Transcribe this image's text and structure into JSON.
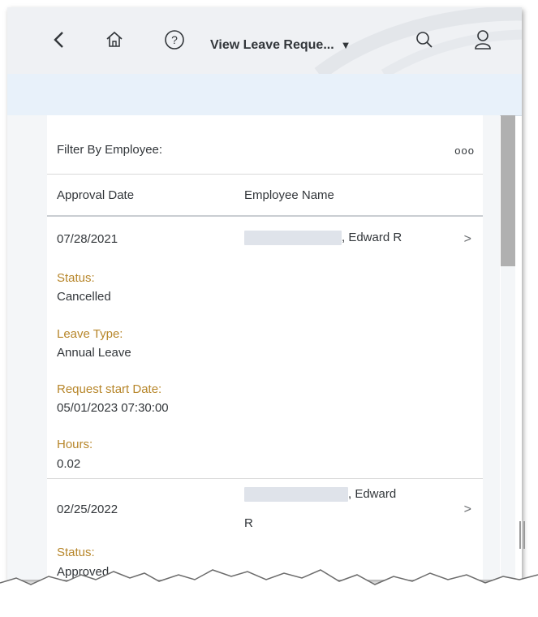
{
  "header": {
    "title": "View Leave Reque...",
    "title_caret": "▼",
    "icons": [
      "back-icon",
      "home-icon",
      "help-icon",
      "search-icon",
      "user-icon"
    ]
  },
  "toolbar": {
    "filter_label": "Filter By Employee:",
    "more_label": "ooo"
  },
  "table": {
    "columns": [
      "Approval Date",
      "Employee Name"
    ],
    "rows": [
      {
        "approval_date": "07/28/2021",
        "employee_name_suffix": ", Edward R",
        "details": [
          {
            "label": "Status:",
            "value": "Cancelled"
          },
          {
            "label": "Leave Type:",
            "value": "Annual Leave"
          },
          {
            "label": "Request start Date:",
            "value": "05/01/2023 07:30:00"
          },
          {
            "label": "Hours:",
            "value": "0.02"
          }
        ]
      },
      {
        "approval_date": "02/25/2022",
        "employee_name_suffix": ", Edward",
        "employee_name_line2": "R",
        "details": [
          {
            "label": "Status:",
            "value": "Approved"
          }
        ]
      }
    ]
  },
  "chevron": ">",
  "colors": {
    "label_gold": "#b7862a",
    "shell_bg": "#eff1f4",
    "subband_bg": "#e8f1fa",
    "text": "#32363a"
  }
}
